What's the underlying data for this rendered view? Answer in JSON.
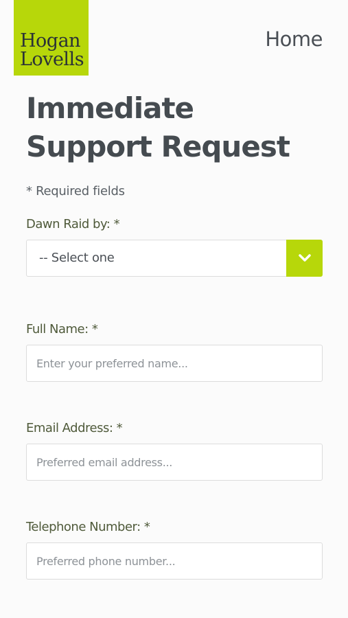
{
  "header": {
    "logo_line1": "Hogan",
    "logo_line2": "Lovells",
    "home_link": "Home"
  },
  "form": {
    "title": "Immediate Support Request",
    "required_note": "* Required fields",
    "dawn_raid": {
      "label": "Dawn Raid by: *",
      "selected": "-- Select one"
    },
    "full_name": {
      "label": "Full Name: *",
      "placeholder": "Enter your preferred name..."
    },
    "email": {
      "label": "Email Address: *",
      "placeholder": "Preferred email address..."
    },
    "telephone": {
      "label": "Telephone Number: *",
      "placeholder": "Preferred phone number..."
    }
  },
  "colors": {
    "brand_green": "#b7d70a",
    "text_dark": "#454b50",
    "label_green": "#4f5a3a"
  },
  "icons": {
    "dropdown": "chevron-down-icon"
  }
}
